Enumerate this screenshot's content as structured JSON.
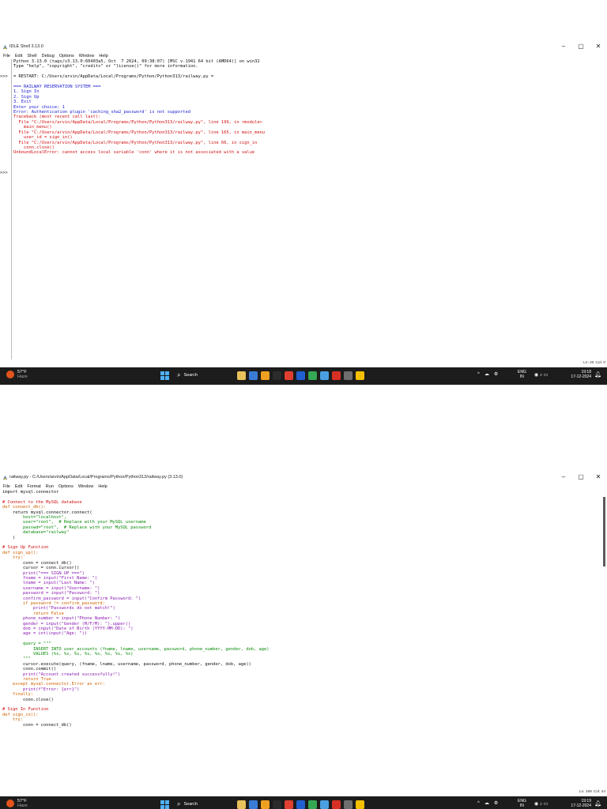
{
  "shell_window": {
    "title": "IDLE Shell 3.13.0",
    "controls": {
      "minimize": "–",
      "maximize": "▢",
      "close": "✕"
    },
    "menu": [
      "File",
      "Edit",
      "Shell",
      "Debug",
      "Options",
      "Window",
      "Help"
    ],
    "prompts": [
      ">>>",
      ">>>"
    ],
    "lines": [
      {
        "text": "Python 3.13.0 (tags/v3.13.0:60403a5, Oct  7 2024, 09:38:07) [MSC v.1941 64 bit (AMD64)] on win32",
        "color": "black"
      },
      {
        "text": "Type \"help\", \"copyright\", \"credits\" or \"license()\" for more information.",
        "color": "black"
      },
      {
        "text": "",
        "color": "black"
      },
      {
        "text": "= RESTART: C:/Users/arvin/AppData/Local/Programs/Python/Python313/railway.py =",
        "color": "black"
      },
      {
        "text": "",
        "color": "black"
      },
      {
        "text": "=== RAILWAY RESERVATION SYSTEM ===",
        "color": "blue"
      },
      {
        "text": "1. Sign In",
        "color": "blue"
      },
      {
        "text": "2. Sign Up",
        "color": "blue"
      },
      {
        "text": "3. Exit",
        "color": "blue"
      },
      {
        "text": "Enter your choice: 1",
        "color": "blue"
      },
      {
        "text": "Error: Authentication plugin 'caching_sha2_password' is not supported",
        "color": "blue"
      },
      {
        "text": "Traceback (most recent call last):",
        "color": "red"
      },
      {
        "text": "  File \"C:/Users/arvin/AppData/Local/Programs/Python/Python313/railway.py\", line 199, in <module>",
        "color": "red"
      },
      {
        "text": "    main_menu()",
        "color": "red"
      },
      {
        "text": "  File \"C:/Users/arvin/AppData/Local/Programs/Python/Python313/railway.py\", line 165, in main_menu",
        "color": "red"
      },
      {
        "text": "    user_id = sign_in()",
        "color": "red"
      },
      {
        "text": "  File \"C:/Users/arvin/AppData/Local/Programs/Python/Python313/railway.py\", line 66, in sign_in",
        "color": "red"
      },
      {
        "text": "    conn.close()",
        "color": "red"
      },
      {
        "text": "UnboundLocalError: cannot access local variable 'conn' where it is not associated with a value",
        "color": "red"
      }
    ],
    "status": {
      "line": "Ln: 20",
      "col": "Col: 0"
    }
  },
  "editor_window": {
    "title": "railway.py - C:/Users/arvin/AppData/Local/Programs/Python/Python313/railway.py (3.13.0)",
    "controls": {
      "minimize": "–",
      "maximize": "▢",
      "close": "✕"
    },
    "menu": [
      "File",
      "Edit",
      "Format",
      "Run",
      "Options",
      "Window",
      "Help"
    ],
    "lines": [
      {
        "text": "import mysql.connector",
        "color": "black"
      },
      {
        "text": "",
        "color": "black"
      },
      {
        "text": "# Connect to the MySQL database",
        "color": "red"
      },
      {
        "text": "def connect_db():",
        "color": "orange"
      },
      {
        "text": "    return mysql.connector.connect(",
        "color": "black"
      },
      {
        "text": "        host=\"localhost\",",
        "color": "green"
      },
      {
        "text": "        user=\"root\",  # Replace with your MySQL username",
        "color": "green"
      },
      {
        "text": "        passwd=\"root\",  # Replace with your MySQL password",
        "color": "green"
      },
      {
        "text": "        database=\"railway\"",
        "color": "green"
      },
      {
        "text": "    )",
        "color": "black"
      },
      {
        "text": "",
        "color": "black"
      },
      {
        "text": "# Sign Up Function",
        "color": "red"
      },
      {
        "text": "def sign_up():",
        "color": "orange"
      },
      {
        "text": "    try:",
        "color": "orange"
      },
      {
        "text": "        conn = connect_db()",
        "color": "black"
      },
      {
        "text": "        cursor = conn.cursor()",
        "color": "black"
      },
      {
        "text": "        print(\"=== SIGN UP ===\")",
        "color": "purple"
      },
      {
        "text": "        fname = input(\"First Name: \")",
        "color": "purple"
      },
      {
        "text": "        lname = input(\"Last Name: \")",
        "color": "purple"
      },
      {
        "text": "        username = input(\"Username: \")",
        "color": "purple"
      },
      {
        "text": "        password = input(\"Password: \")",
        "color": "purple"
      },
      {
        "text": "        confirm_password = input(\"Confirm Password: \")",
        "color": "purple"
      },
      {
        "text": "        if password != confirm_password:",
        "color": "orange"
      },
      {
        "text": "            print(\"Passwords do not match!\")",
        "color": "purple"
      },
      {
        "text": "            return False",
        "color": "orange"
      },
      {
        "text": "        phone_number = input(\"Phone Number: \")",
        "color": "purple"
      },
      {
        "text": "        gender = input(\"Gender (M/F/M): \").upper()",
        "color": "purple"
      },
      {
        "text": "        dob = input(\"Date of Birth (YYYY-MM-DD): \")",
        "color": "purple"
      },
      {
        "text": "        age = int(input(\"Age: \"))",
        "color": "purple"
      },
      {
        "text": "",
        "color": "black"
      },
      {
        "text": "        query = \"\"\"",
        "color": "green"
      },
      {
        "text": "            INSERT INTO user_accounts (fname, lname, username, password, phone_number, gender, dob, age)",
        "color": "green"
      },
      {
        "text": "            VALUES (%s, %s, %s, %s, %s, %s, %s, %s)",
        "color": "green"
      },
      {
        "text": "        \"\"\"",
        "color": "green"
      },
      {
        "text": "        cursor.execute(query, (fname, lname, username, password, phone_number, gender, dob, age))",
        "color": "black"
      },
      {
        "text": "        conn.commit()",
        "color": "black"
      },
      {
        "text": "        print(\"Account created successfully!\")",
        "color": "purple"
      },
      {
        "text": "        return True",
        "color": "orange"
      },
      {
        "text": "    except mysql.connector.Error as err:",
        "color": "orange"
      },
      {
        "text": "        print(f\"Error: {err}\")",
        "color": "purple"
      },
      {
        "text": "    finally:",
        "color": "orange"
      },
      {
        "text": "        conn.close()",
        "color": "black"
      },
      {
        "text": "",
        "color": "black"
      },
      {
        "text": "# Sign In Function",
        "color": "red"
      },
      {
        "text": "def sign_in():",
        "color": "orange"
      },
      {
        "text": "    try:",
        "color": "orange"
      },
      {
        "text": "        conn = connect_db()",
        "color": "black"
      }
    ],
    "status": {
      "line": "Ln: 169",
      "col": "Col: 44"
    }
  },
  "taskbar": {
    "weather_temp": "57°F",
    "weather_desc": "Haze",
    "search_label": "Search",
    "lang_top": "ENG",
    "lang_bottom": "IN",
    "time": "19:18",
    "date": "17-12-2024",
    "time_2": "19:19",
    "date_2": "17-12-2024",
    "app_colors": [
      "#e8c15a",
      "#3a7bd5",
      "#f0a020",
      "#2b2b2b",
      "#e04030",
      "#2060d0",
      "#34a853",
      "#4aa0e0",
      "#d93025",
      "#6e6e6e",
      "#f3c000"
    ]
  }
}
